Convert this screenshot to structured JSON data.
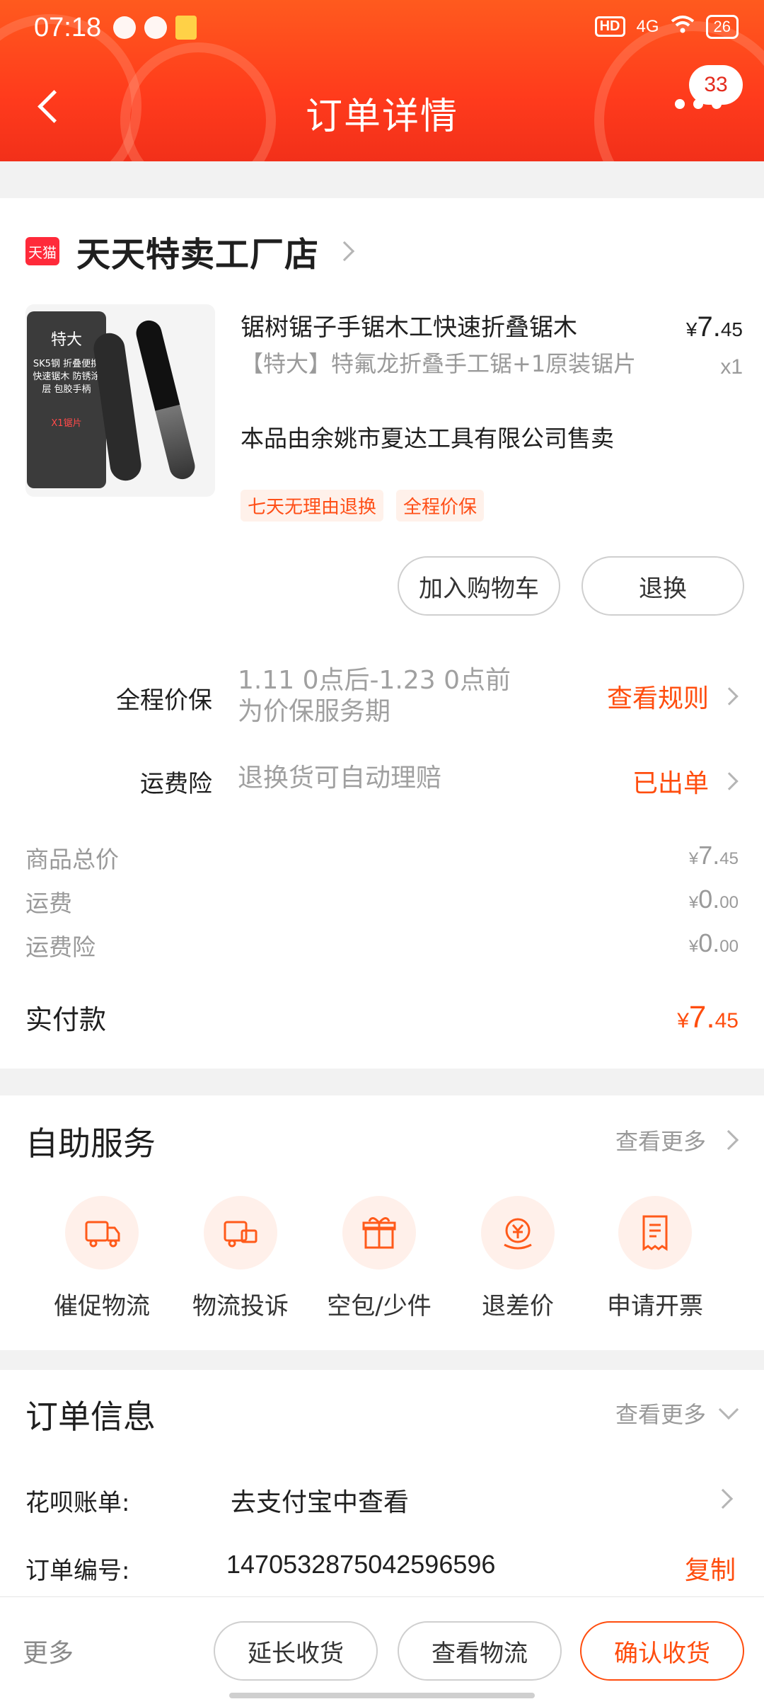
{
  "status_bar": {
    "time": "07:18",
    "network": "4G",
    "battery": "26",
    "hd": "HD",
    "app_badge": "米读"
  },
  "header": {
    "title": "订单详情",
    "badge_count": "33"
  },
  "shop": {
    "logo_text": "天猫",
    "name": "天天特卖工厂店"
  },
  "product": {
    "image_tag_big": "特大",
    "image_tag_lines": "SK5钢 折叠便携 快速锯木 防锈涂层 包胶手柄",
    "image_tag_bottom": "X1锯片",
    "title": "锯树锯子手锯木工快速折叠锯木",
    "sku": "【特大】特氟龙折叠手工锯+1原装锯片",
    "seller": "本品由余姚市夏达工具有限公司售卖",
    "tags": [
      "七天无理由退换",
      "全程价保"
    ],
    "price_symbol": "¥",
    "price_int": "7.",
    "price_dec": "45",
    "qty": "x1",
    "add_cart": "加入购物车",
    "return_exchange": "退换"
  },
  "services": [
    {
      "label": "全程价保",
      "desc": "1.11 0点后-1.23 0点前为价保服务期",
      "link": "查看规则"
    },
    {
      "label": "运费险",
      "desc": "退换货可自动理赔",
      "link": "已出单"
    }
  ],
  "fees": [
    {
      "label": "商品总价",
      "symbol": "¥",
      "int": "7.",
      "dec": "45"
    },
    {
      "label": "运费",
      "symbol": "¥",
      "int": "0.",
      "dec": "00"
    },
    {
      "label": "运费险",
      "symbol": "¥",
      "int": "0.",
      "dec": "00"
    }
  ],
  "paid": {
    "label": "实付款",
    "symbol": "¥",
    "int": "7.",
    "dec": "45"
  },
  "self_service": {
    "title": "自助服务",
    "more": "查看更多",
    "items": [
      {
        "label": "催促物流",
        "icon": "truck-bell-icon"
      },
      {
        "label": "物流投诉",
        "icon": "truck-complaint-icon"
      },
      {
        "label": "空包/少件",
        "icon": "gift-box-icon"
      },
      {
        "label": "退差价",
        "icon": "yuan-refund-icon"
      },
      {
        "label": "申请开票",
        "icon": "invoice-icon"
      }
    ]
  },
  "order_info": {
    "title": "订单信息",
    "more": "查看更多",
    "huabei_label": "花呗账单:",
    "huabei_value": "去支付宝中查看",
    "order_no_label": "订单编号:",
    "order_no_value": "1470532875042596596",
    "copy": "复制"
  },
  "bottom_bar": {
    "more": "更多",
    "extend": "延长收货",
    "logistics": "查看物流",
    "confirm": "确认收货"
  },
  "colors": {
    "accent": "#ff4d0e",
    "header": "#ff3b1c"
  }
}
